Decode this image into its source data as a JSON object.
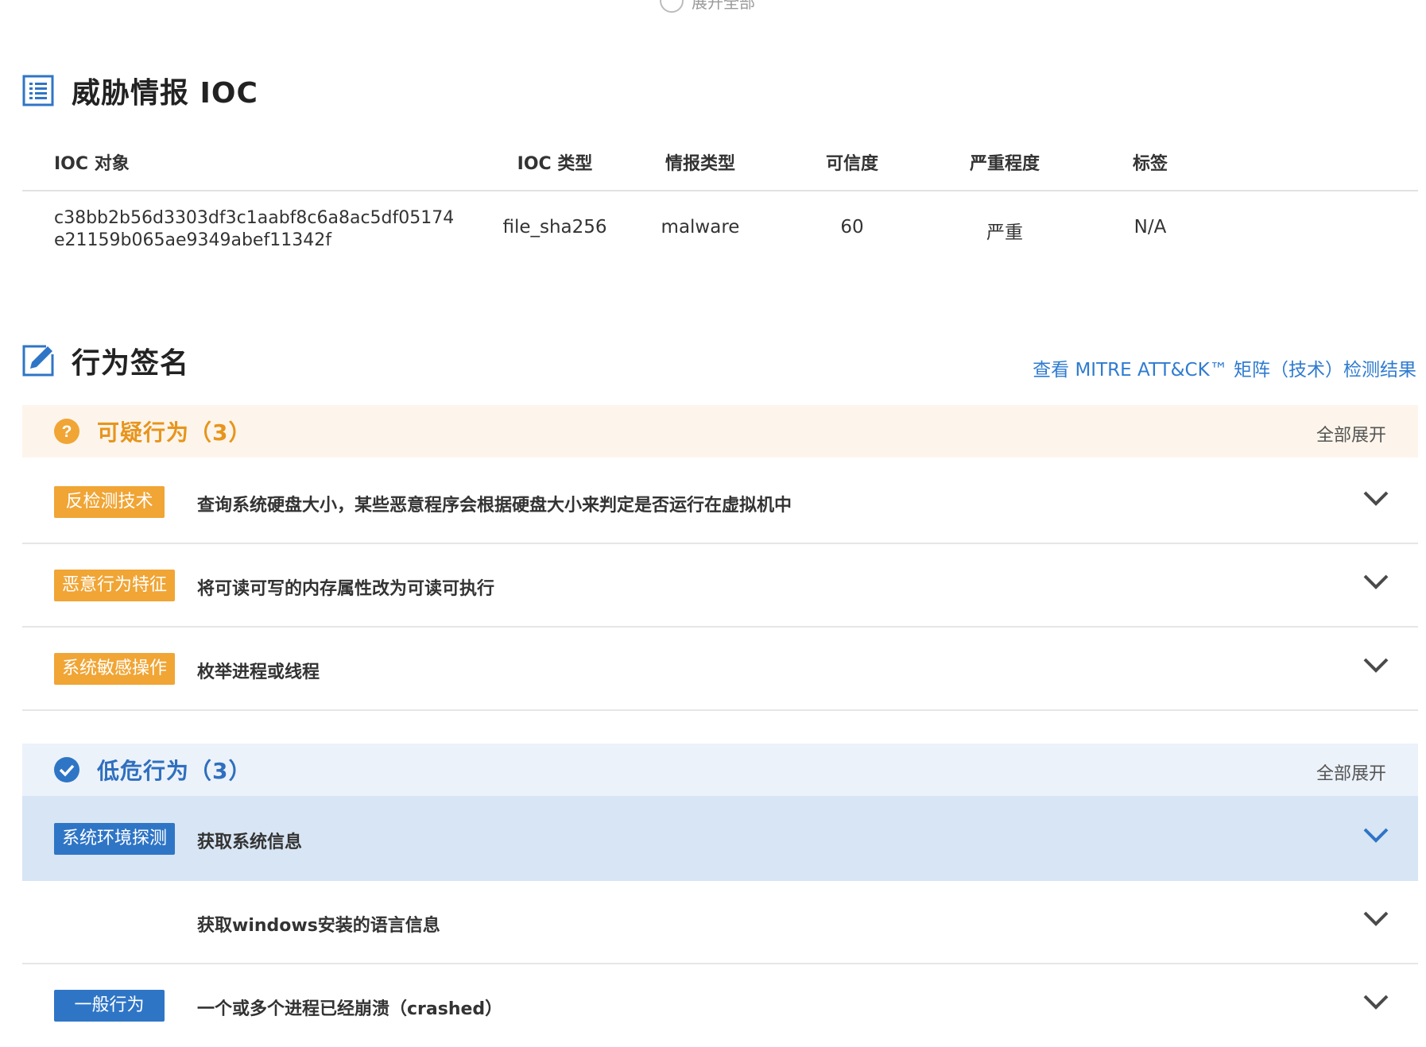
{
  "top": {
    "expand_all_partial": "展开全部"
  },
  "ioc_section": {
    "title": "威胁情报 IOC",
    "columns": [
      "IOC 对象",
      "IOC 类型",
      "情报类型",
      "可信度",
      "严重程度",
      "标签"
    ],
    "rows": [
      {
        "object_line1": "c38bb2b56d3303df3c1aabf8c6a8ac5df05174",
        "object_line2": "e21159b065ae9349abef11342f",
        "ioc_type": "file_sha256",
        "intel_type": "malware",
        "confidence": "60",
        "severity": "严重",
        "tags": "N/A"
      }
    ]
  },
  "behavior_section": {
    "title": "行为签名",
    "mitre_link": "查看 MITRE ATT&CK™ 矩阵（技术）检测结果"
  },
  "suspicious_group": {
    "title": "可疑行为（3）",
    "expand_all": "全部展开",
    "accent": "#f0a535",
    "items": [
      {
        "tag": "反检测技术",
        "desc": "查询系统硬盘大小，某些恶意程序会根据硬盘大小来判定是否运行在虚拟机中",
        "icon": "chevron-down-icon"
      },
      {
        "tag": "恶意行为特征",
        "desc": "将可读可写的内存属性改为可读可执行",
        "icon": "chevron-down-icon"
      },
      {
        "tag": "系统敏感操作",
        "desc": "枚举进程或线程",
        "icon": "chevron-down-icon"
      }
    ]
  },
  "low_risk_group": {
    "title": "低危行为（3）",
    "expand_all": "全部展开",
    "accent": "#2f75c6",
    "items": [
      {
        "tag": "系统环境探测",
        "desc": "获取系统信息",
        "icon": "chevron-down-icon",
        "active": true
      },
      {
        "tag": "",
        "desc": "获取windows安装的语言信息",
        "icon": "chevron-down-icon"
      },
      {
        "tag": "一般行为",
        "desc": "一个或多个进程已经崩溃（crashed）",
        "icon": "chevron-down-icon"
      }
    ]
  }
}
